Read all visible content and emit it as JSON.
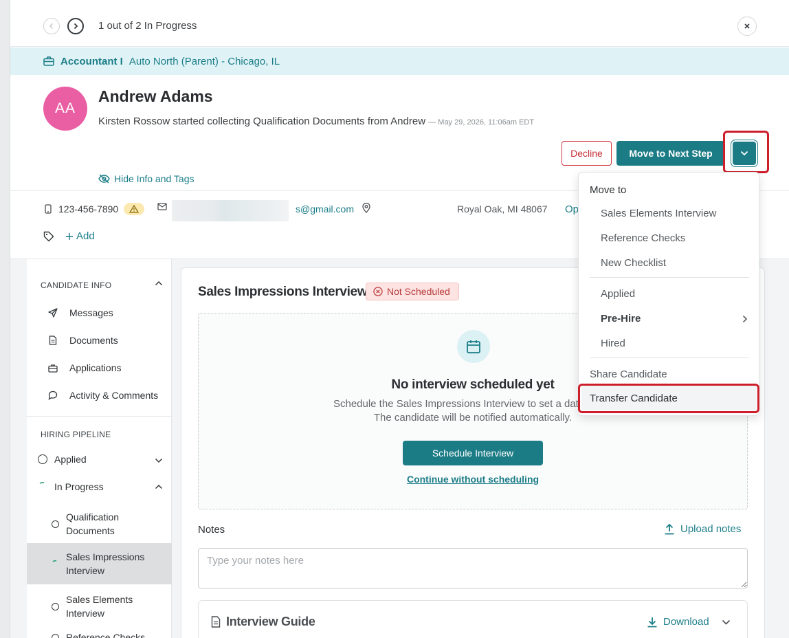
{
  "nav": {
    "counter": "1 out of 2 In Progress"
  },
  "job": {
    "title": "Accountant I",
    "location": "Auto North (Parent) - Chicago, IL"
  },
  "candidate": {
    "initials": "AA",
    "avatar_color": "#ea5ea3",
    "name": "Andrew Adams",
    "activity": "Kirsten Rossow started collecting Qualification Documents from Andrew",
    "activity_timestamp": "— May 29, 2026, 11:06am EDT",
    "phone": "123-456-7890",
    "email_visible": "s@gmail.com",
    "location": "Royal Oak, MI 48067",
    "partial_link": "Op"
  },
  "actions": {
    "decline": "Decline",
    "next_step": "Move to Next Step",
    "hide_info": "Hide Info and Tags",
    "add_tag": "Add"
  },
  "sidebar": {
    "candidate_info_heading": "CANDIDATE INFO",
    "info_items": [
      {
        "label": "Messages",
        "icon": "send-icon"
      },
      {
        "label": "Documents",
        "icon": "document-icon"
      },
      {
        "label": "Applications",
        "icon": "briefcase-icon"
      },
      {
        "label": "Activity & Comments",
        "icon": "comment-icon"
      }
    ],
    "pipeline_heading": "HIRING PIPELINE",
    "pipeline": [
      {
        "label": "Applied"
      },
      {
        "label": "In Progress"
      }
    ],
    "sub_stages": [
      {
        "label": "Qualification Documents"
      },
      {
        "label": "Sales Impressions Interview",
        "active": true
      },
      {
        "label": "Sales Elements Interview"
      },
      {
        "label": "Reference Checks"
      }
    ]
  },
  "main": {
    "stage_title": "Sales Impressions Interview",
    "status_badge": "Not Scheduled",
    "empty_title": "No interview scheduled yet",
    "empty_desc_line1": "Schedule the Sales Impressions Interview to set a date, time,",
    "empty_desc_line2": "The candidate will be notified automatically.",
    "schedule_button": "Schedule Interview",
    "continue_link": "Continue without scheduling",
    "notes_label": "Notes",
    "upload_notes": "Upload notes",
    "notes_placeholder": "Type your notes here",
    "guide_title": "Interview Guide",
    "guide_download": "Download"
  },
  "menu": {
    "heading": "Move to",
    "stage_items": [
      "Sales Elements Interview",
      "Reference Checks",
      "New Checklist"
    ],
    "pipeline_items": [
      "Applied",
      "Pre-Hire",
      "Hired"
    ],
    "share": "Share Candidate",
    "transfer": "Transfer Candidate"
  },
  "colors": {
    "accent": "#1c7c86",
    "danger": "#cc1f2b",
    "banner_bg": "#dff3f6"
  }
}
